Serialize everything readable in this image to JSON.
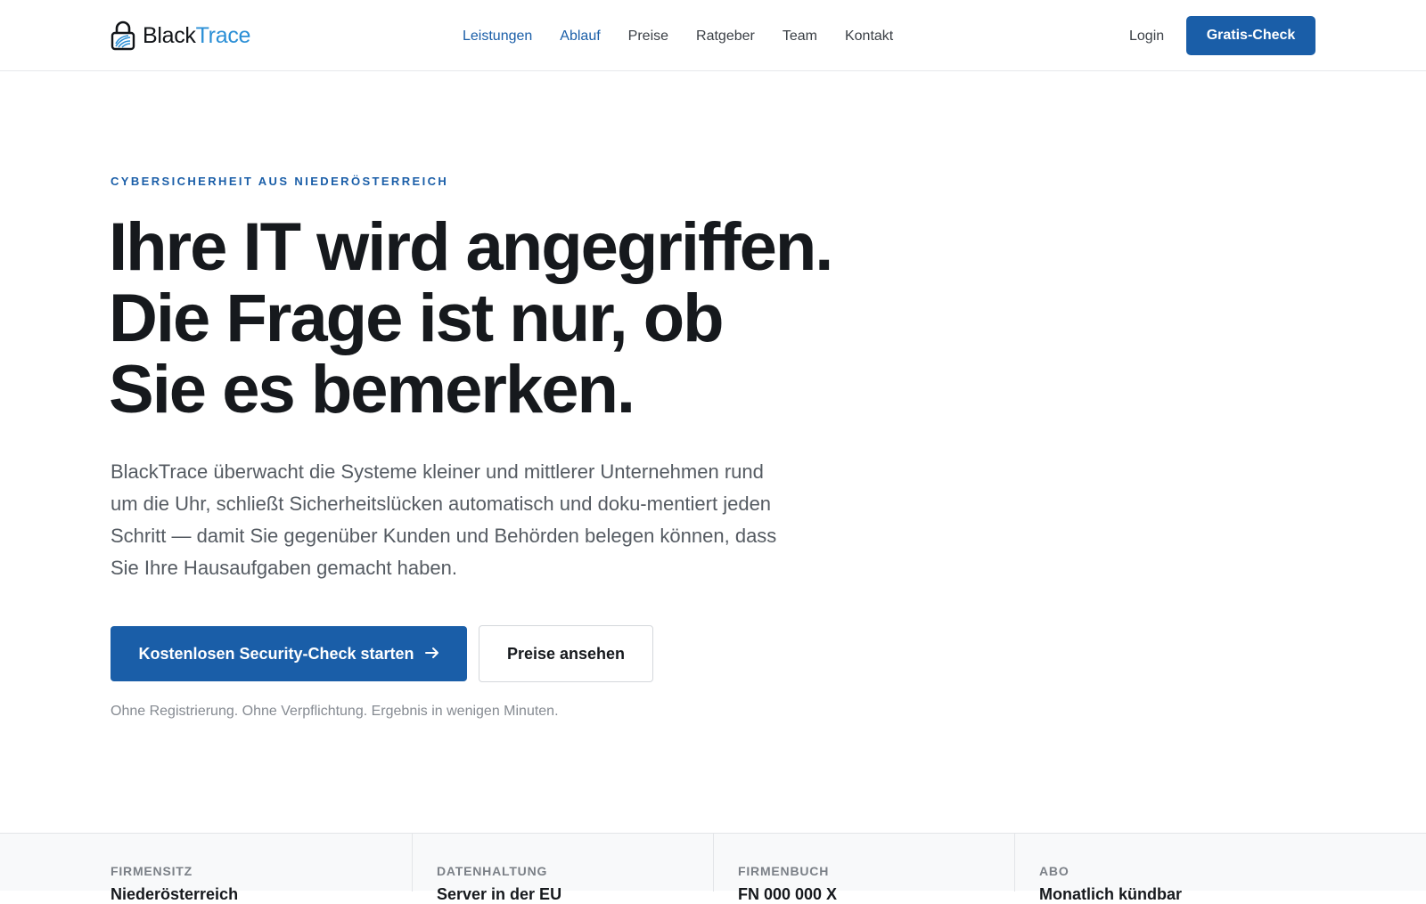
{
  "brand": {
    "name_part1": "Black",
    "name_part2": "Trace",
    "accent_color": "#2b8fd6",
    "primary_color": "#1a5ea8"
  },
  "nav": {
    "items": [
      {
        "label": "Leistungen",
        "active": true
      },
      {
        "label": "Ablauf",
        "active": true
      },
      {
        "label": "Preise",
        "active": false
      },
      {
        "label": "Ratgeber",
        "active": false
      },
      {
        "label": "Team",
        "active": false
      },
      {
        "label": "Kontakt",
        "active": false
      }
    ],
    "login_label": "Login",
    "cta_label": "Gratis-Check"
  },
  "hero": {
    "eyebrow": "CYBERSICHERHEIT AUS NIEDERÖSTERREICH",
    "headline_lines": [
      "Ihre IT wird angegriffen.",
      "Die Frage ist nur, ob",
      "Sie es bemerken."
    ],
    "lead": "BlackTrace überwacht die Systeme kleiner und mittlerer Unternehmen rund um die Uhr, schließt Sicherheitslücken automatisch und doku-mentiert jeden Schritt — damit Sie gegenüber Kunden und Behörden belegen können, dass Sie Ihre Hausaufgaben gemacht haben.",
    "primary_cta": "Kostenlosen Security-Check starten",
    "primary_cta_icon": "arrow-right-icon",
    "secondary_cta": "Preise ansehen",
    "fineprint": "Ohne Registrierung. Ohne Verpflichtung. Ergebnis in wenigen Minuten."
  },
  "info_strip": [
    {
      "label": "FIRMENSITZ",
      "value": "Niederösterreich"
    },
    {
      "label": "DATENHALTUNG",
      "value": "Server in der EU"
    },
    {
      "label": "FIRMENBUCH",
      "value": "FN 000 000 X"
    },
    {
      "label": "ABO",
      "value": "Monatlich kündbar"
    }
  ]
}
